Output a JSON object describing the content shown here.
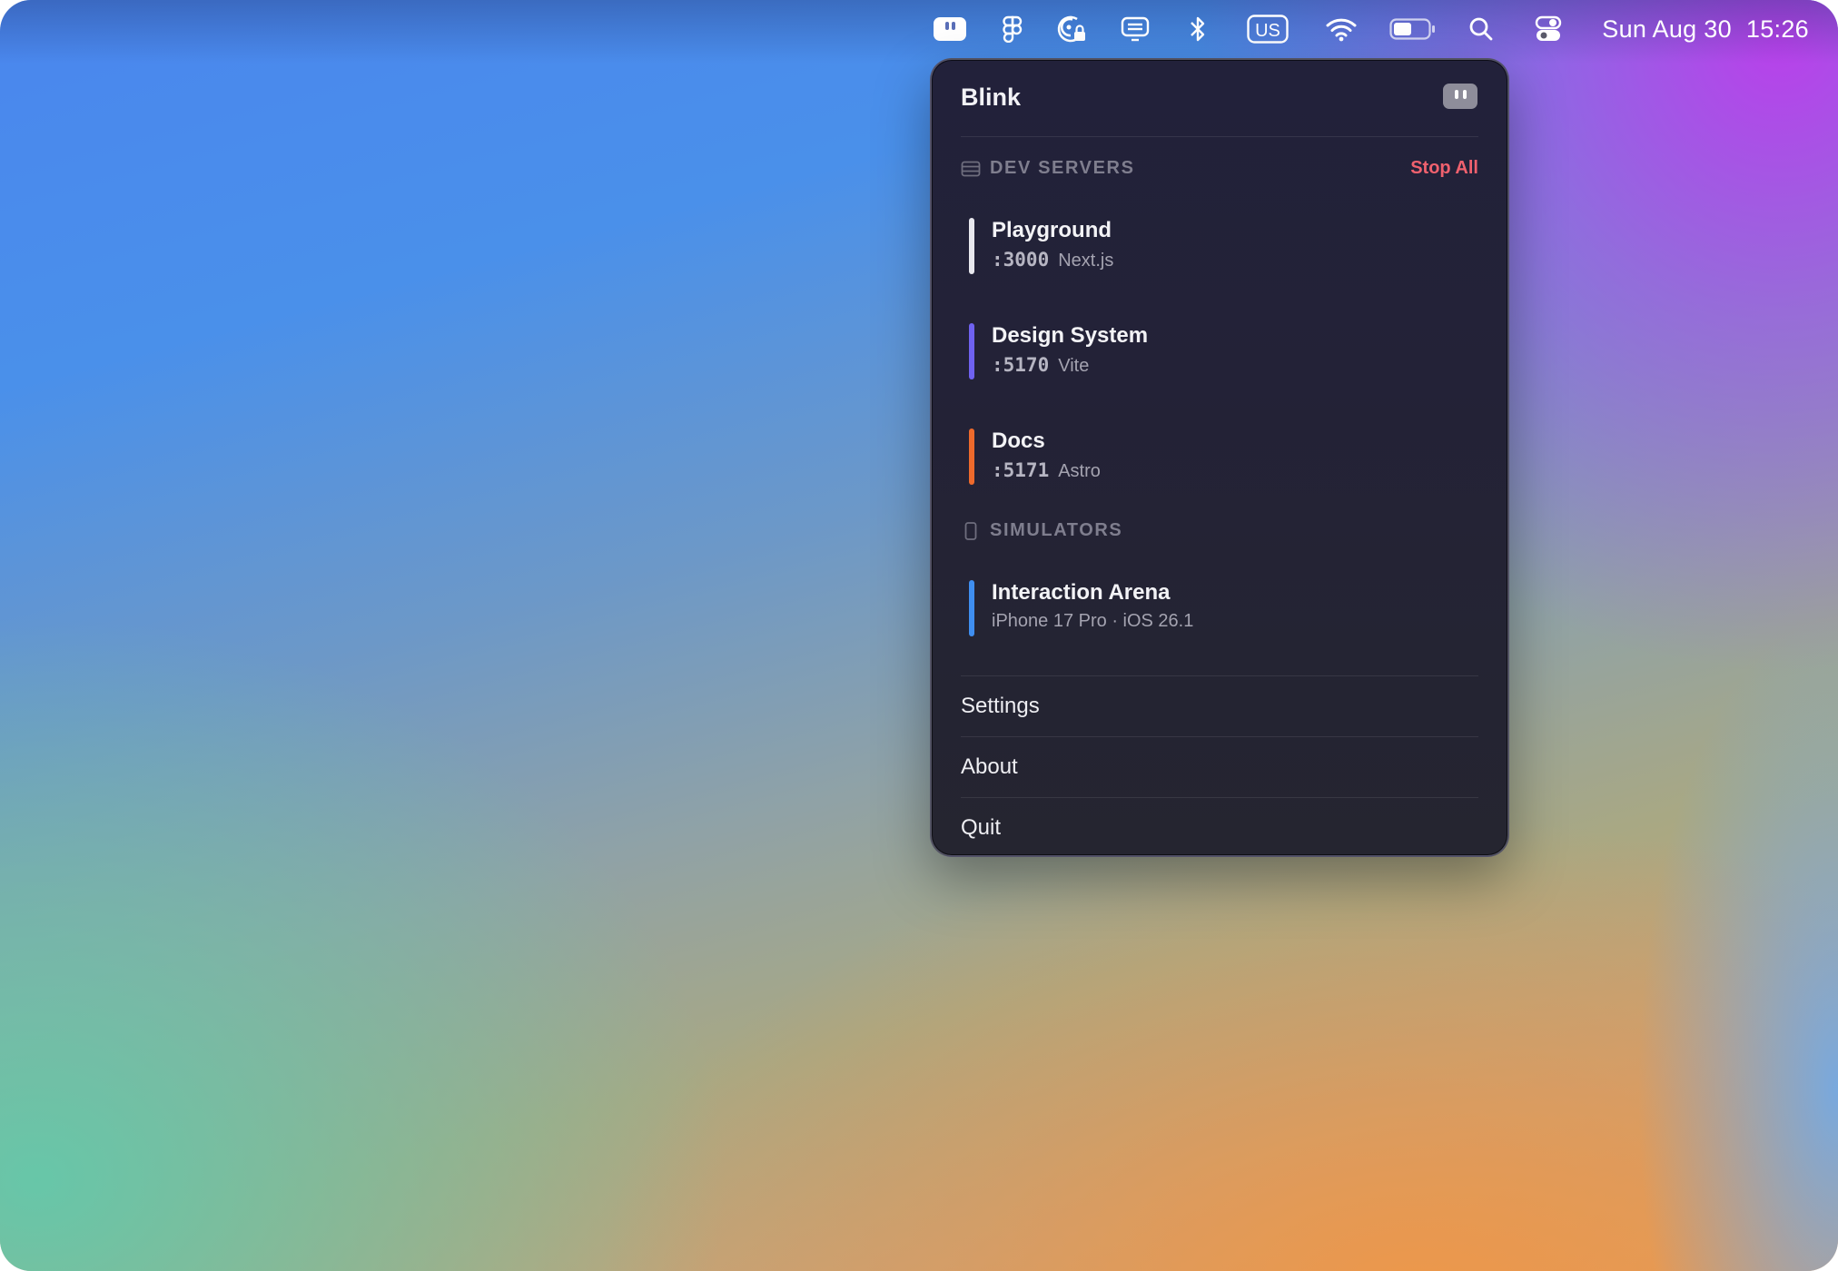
{
  "menubar": {
    "icons": [
      "blink-app-icon",
      "figma-icon",
      "password-lock-icon",
      "display-icon",
      "bluetooth-icon",
      "keyboard-input-icon",
      "wifi-icon",
      "battery-icon",
      "search-icon",
      "control-center-icon"
    ],
    "input_source": "US",
    "date": "Sun Aug 30",
    "time": "15:26"
  },
  "popover": {
    "title": "Blink",
    "dev_servers": {
      "heading": "DEV SERVERS",
      "stop_all_label": "Stop All",
      "items": [
        {
          "name": "Playground",
          "port": ":3000",
          "framework": "Next.js",
          "color": "#e8e8ee"
        },
        {
          "name": "Design System",
          "port": ":5170",
          "framework": "Vite",
          "color": "#6f62f0"
        },
        {
          "name": "Docs",
          "port": ":5171",
          "framework": "Astro",
          "color": "#ee6a2c"
        }
      ]
    },
    "simulators": {
      "heading": "SIMULATORS",
      "items": [
        {
          "name": "Interaction Arena",
          "detail": "iPhone 17 Pro · iOS 26.1",
          "color": "#3f8ef0"
        }
      ]
    },
    "menu": {
      "settings": "Settings",
      "about": "About",
      "quit": "Quit"
    }
  },
  "colors": {
    "accent_red": "#f0616e",
    "panel_background": "#23223a"
  }
}
